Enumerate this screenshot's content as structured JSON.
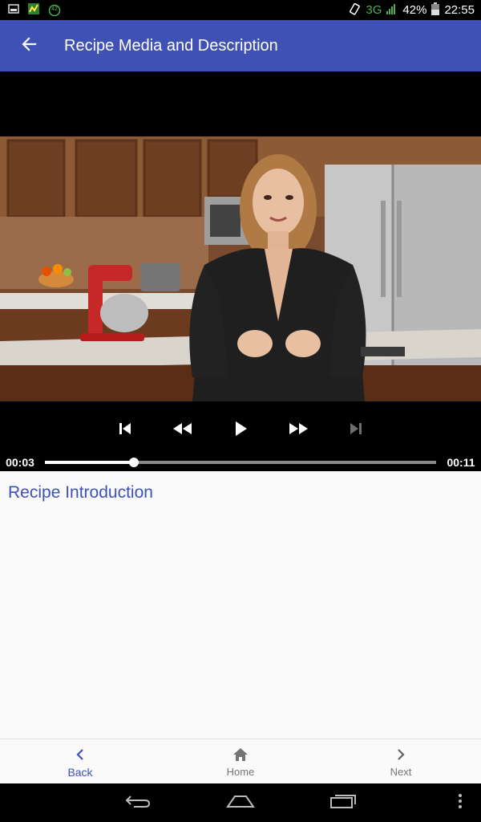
{
  "status_bar": {
    "notification_badge": "42",
    "network": "3G",
    "battery": "42%",
    "time": "22:55"
  },
  "app_bar": {
    "title": "Recipe Media and Description"
  },
  "player": {
    "current_time": "00:03",
    "duration": "00:11",
    "progress_fraction": 0.227
  },
  "content": {
    "step_title": "Recipe Introduction"
  },
  "bottom_nav": {
    "back_label": "Back",
    "home_label": "Home",
    "next_label": "Next"
  },
  "colors": {
    "primary": "#3f51b5",
    "status_network": "#4caf50"
  },
  "icons": {
    "app_bar": "arrow-back-icon",
    "controls": [
      "skip-previous-icon",
      "rewind-icon",
      "play-icon",
      "fast-forward-icon",
      "skip-next-icon"
    ],
    "nav": [
      "chevron-left-icon",
      "home-icon",
      "chevron-right-icon"
    ],
    "system": [
      "system-back-icon",
      "system-home-icon",
      "system-recents-icon",
      "overflow-menu-icon"
    ]
  }
}
